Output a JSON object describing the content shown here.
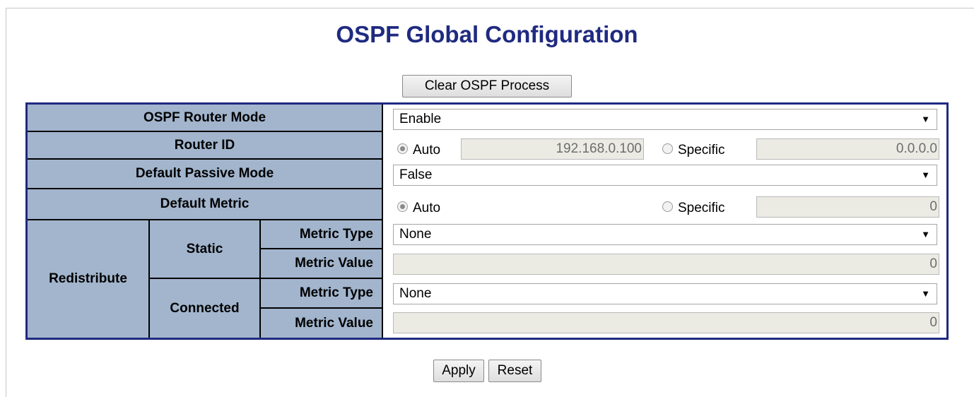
{
  "page": {
    "title": "OSPF Global Configuration"
  },
  "toolbar": {
    "clear_label": "Clear OSPF Process"
  },
  "rows": {
    "router_mode": {
      "label": "OSPF Router Mode",
      "value": "Enable"
    },
    "router_id": {
      "label": "Router ID",
      "auto_label": "Auto",
      "auto_selected": true,
      "auto_value": "192.168.0.100",
      "specific_label": "Specific",
      "specific_value": "0.0.0.0"
    },
    "passive_mode": {
      "label": "Default Passive Mode",
      "value": "False"
    },
    "default_metric": {
      "label": "Default Metric",
      "auto_label": "Auto",
      "auto_selected": true,
      "specific_label": "Specific",
      "specific_value": "0"
    },
    "redistribute": {
      "label": "Redistribute",
      "static": {
        "label": "Static",
        "metric_type_label": "Metric Type",
        "metric_type_value": "None",
        "metric_value_label": "Metric Value",
        "metric_value": "0"
      },
      "connected": {
        "label": "Connected",
        "metric_type_label": "Metric Type",
        "metric_type_value": "None",
        "metric_value_label": "Metric Value",
        "metric_value": "0"
      }
    }
  },
  "footer": {
    "apply_label": "Apply",
    "reset_label": "Reset"
  },
  "icons": {
    "dropdown_arrow": "▼"
  },
  "colors": {
    "title": "#1f2a80",
    "header_cell": "#a2b5cd",
    "table_border": "#1f2a80",
    "readonly_field": "#ebebe4"
  }
}
